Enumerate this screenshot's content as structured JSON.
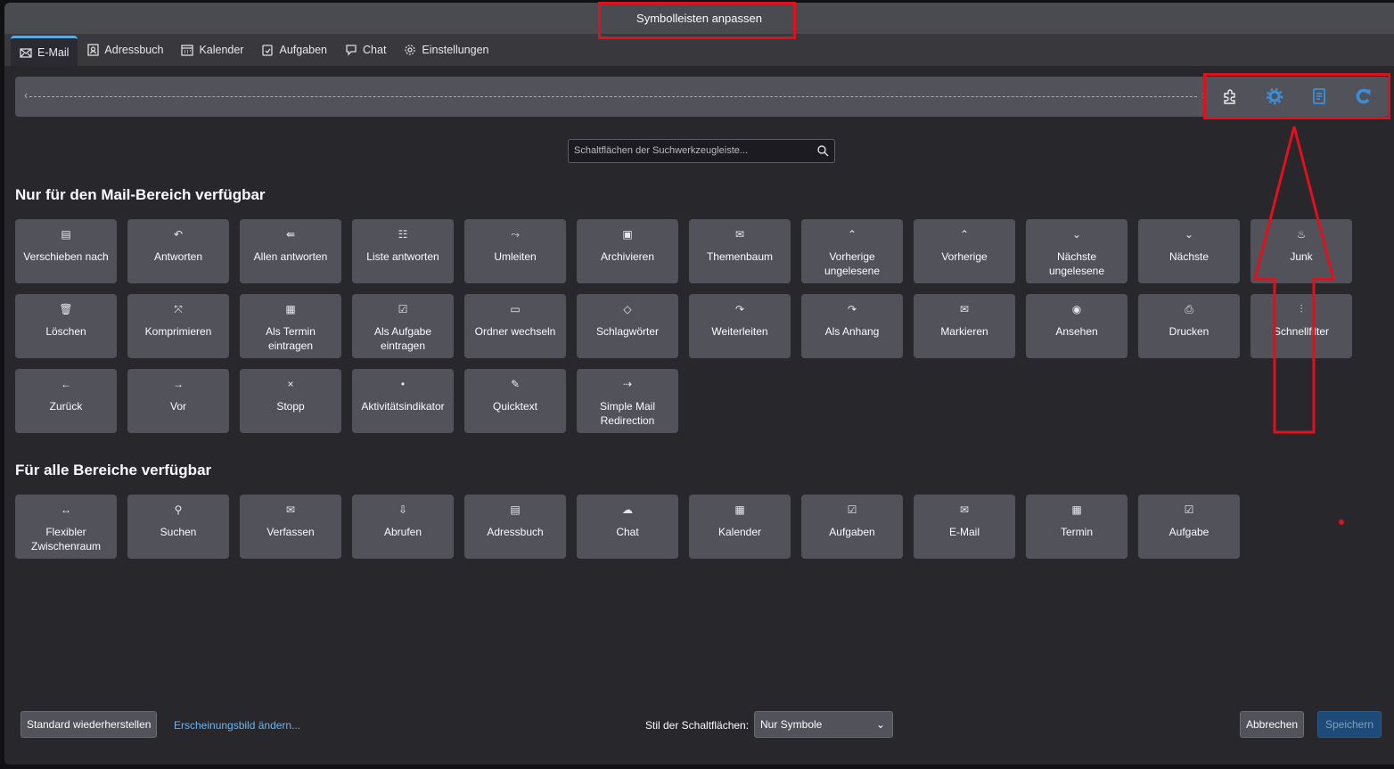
{
  "window": {
    "title": "Symbolleisten anpassen"
  },
  "tabs": [
    {
      "label": "E-Mail",
      "icon": "mail-icon"
    },
    {
      "label": "Adressbuch",
      "icon": "addressbook-icon"
    },
    {
      "label": "Kalender",
      "icon": "calendar-icon"
    },
    {
      "label": "Aufgaben",
      "icon": "tasks-icon"
    },
    {
      "label": "Chat",
      "icon": "chat-icon"
    },
    {
      "label": "Einstellungen",
      "icon": "gear-icon"
    }
  ],
  "toolbar": {
    "icons": [
      "extension-puzzle-icon",
      "gear-icon",
      "notes-icon",
      "refresh-icon"
    ],
    "accent": "#3b8fd9"
  },
  "search": {
    "placeholder": "Schaltflächen der Suchwerkzeugleiste..."
  },
  "mail_section": {
    "title": "Nur für den Mail-Bereich verfügbar",
    "items": [
      {
        "label": "Verschieben nach",
        "icon": "▤"
      },
      {
        "label": "Antworten",
        "icon": "↶"
      },
      {
        "label": "Allen antworten",
        "icon": "⇚"
      },
      {
        "label": "Liste antworten",
        "icon": "☷"
      },
      {
        "label": "Umleiten",
        "icon": "⤳"
      },
      {
        "label": "Archivieren",
        "icon": "▣"
      },
      {
        "label": "Themenbaum",
        "icon": "✉"
      },
      {
        "label": "Vorherige ungelesene",
        "icon": "⌃"
      },
      {
        "label": "Vorherige",
        "icon": "⌃"
      },
      {
        "label": "Nächste ungelesene",
        "icon": "⌄"
      },
      {
        "label": "Nächste",
        "icon": "⌄"
      },
      {
        "label": "Junk",
        "icon": "♨"
      },
      {
        "label": "Löschen",
        "icon": "🗑"
      },
      {
        "label": "Komprimieren",
        "icon": "⤧"
      },
      {
        "label": "Als Termin eintragen",
        "icon": "▦"
      },
      {
        "label": "Als Aufgabe eintragen",
        "icon": "☑"
      },
      {
        "label": "Ordner wechseln",
        "icon": "▭"
      },
      {
        "label": "Schlagwörter",
        "icon": "◇"
      },
      {
        "label": "Weiterleiten",
        "icon": "↷"
      },
      {
        "label": "Als Anhang",
        "icon": "↷"
      },
      {
        "label": "Markieren",
        "icon": "✉"
      },
      {
        "label": "Ansehen",
        "icon": "◉"
      },
      {
        "label": "Drucken",
        "icon": "⎙"
      },
      {
        "label": "Schnellfilter",
        "icon": "⫶"
      },
      {
        "label": "Zurück",
        "icon": "←"
      },
      {
        "label": "Vor",
        "icon": "→"
      },
      {
        "label": "Stopp",
        "icon": "×"
      },
      {
        "label": "Aktivitätsindikator",
        "icon": "•"
      },
      {
        "label": "Quicktext",
        "icon": "✎"
      },
      {
        "label": "Simple Mail Redirection",
        "icon": "⇢"
      }
    ]
  },
  "all_section": {
    "title": "Für alle Bereiche verfügbar",
    "items": [
      {
        "label": "Flexibler Zwischenraum",
        "icon": "↔"
      },
      {
        "label": "Suchen",
        "icon": "⚲"
      },
      {
        "label": "Verfassen",
        "icon": "✉"
      },
      {
        "label": "Abrufen",
        "icon": "⇩"
      },
      {
        "label": "Adressbuch",
        "icon": "▤"
      },
      {
        "label": "Chat",
        "icon": "☁"
      },
      {
        "label": "Kalender",
        "icon": "▦"
      },
      {
        "label": "Aufgaben",
        "icon": "☑"
      },
      {
        "label": "E-Mail",
        "icon": "✉"
      },
      {
        "label": "Termin",
        "icon": "▦"
      },
      {
        "label": "Aufgabe",
        "icon": "☑"
      }
    ]
  },
  "footer": {
    "restore": "Standard wiederherstellen",
    "appearance": "Erscheinungsbild ändern...",
    "style_label": "Stil der Schaltflächen:",
    "style_value": "Nur Symbole",
    "cancel": "Abbrechen",
    "save": "Speichern"
  }
}
